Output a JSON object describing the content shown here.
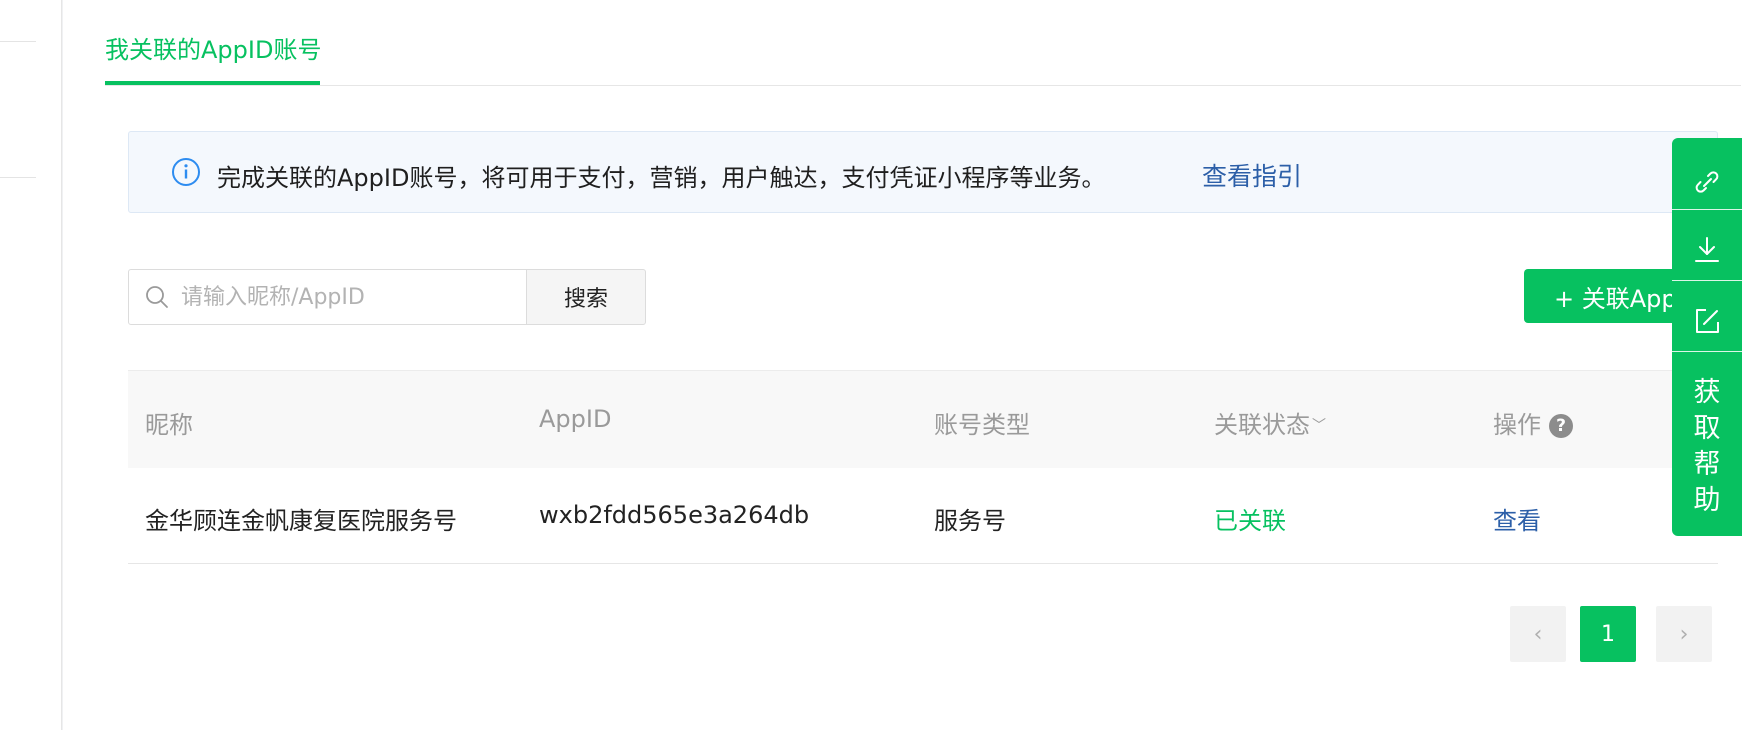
{
  "tabs": {
    "active_label": "我关联的AppID账号"
  },
  "notice": {
    "text": "完成关联的AppID账号，将可用于支付，营销，用户触达，支付凭证小程序等业务。",
    "link_label": "查看指引"
  },
  "search": {
    "placeholder": "请输入昵称/AppID",
    "button_label": "搜索"
  },
  "add_button_label": "+ 关联AppI",
  "table": {
    "columns": [
      "昵称",
      "AppID",
      "账号类型",
      "关联状态",
      "操作"
    ],
    "help_glyph": "?",
    "sort_glyph": "﹀",
    "rows": [
      {
        "nickname": "金华顾连金帆康复医院服务号",
        "appid": "wxb2fdd565e3a264db",
        "type": "服务号",
        "status": "已关联",
        "action": "查看"
      }
    ]
  },
  "pagination": {
    "current": "1",
    "prev_glyph": "‹",
    "next_glyph": "›"
  },
  "float_toolbar": {
    "help_chars": [
      "获",
      "取",
      "帮",
      "助"
    ],
    "icons": [
      "link-icon",
      "download-icon",
      "edit-icon"
    ]
  },
  "colors": {
    "accent": "#07c160",
    "link": "#2c5fa8"
  }
}
